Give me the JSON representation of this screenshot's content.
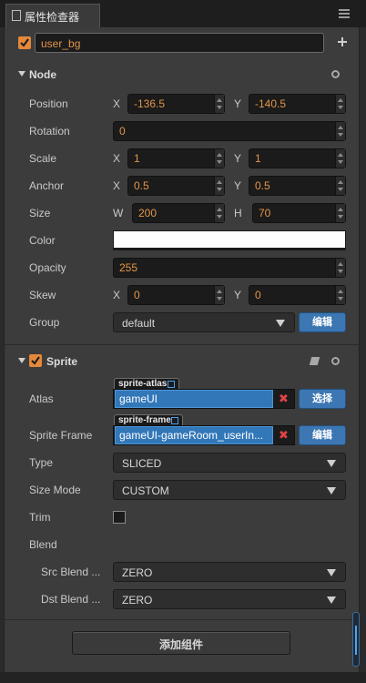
{
  "tab": {
    "title": "属性检查器"
  },
  "node_name": {
    "value": "user_bg"
  },
  "node_section": {
    "title": "Node"
  },
  "position": {
    "label": "Position",
    "x_axis": "X",
    "x": "-136.5",
    "y_axis": "Y",
    "y": "-140.5"
  },
  "rotation": {
    "label": "Rotation",
    "value": "0"
  },
  "scale": {
    "label": "Scale",
    "x_axis": "X",
    "x": "1",
    "y_axis": "Y",
    "y": "1"
  },
  "anchor": {
    "label": "Anchor",
    "x_axis": "X",
    "x": "0.5",
    "y_axis": "Y",
    "y": "0.5"
  },
  "size": {
    "label": "Size",
    "w_axis": "W",
    "w": "200",
    "h_axis": "H",
    "h": "70"
  },
  "color": {
    "label": "Color",
    "value": "#ffffff"
  },
  "opacity": {
    "label": "Opacity",
    "value": "255"
  },
  "skew": {
    "label": "Skew",
    "x_axis": "X",
    "x": "0",
    "y_axis": "Y",
    "y": "0"
  },
  "group": {
    "label": "Group",
    "value": "default",
    "edit_button": "编辑"
  },
  "sprite_section": {
    "title": "Sprite"
  },
  "atlas": {
    "label": "Atlas",
    "tag": "sprite-atlas",
    "value": "gameUI",
    "button": "选择"
  },
  "sprite_frame": {
    "label": "Sprite Frame",
    "tag": "sprite-frame",
    "value": "gameUI-gameRoom_userIn...",
    "button": "编辑"
  },
  "type": {
    "label": "Type",
    "value": "SLICED"
  },
  "size_mode": {
    "label": "Size Mode",
    "value": "CUSTOM"
  },
  "trim": {
    "label": "Trim"
  },
  "blend": {
    "label": "Blend"
  },
  "src_blend": {
    "label": "Src Blend ...",
    "value": "ZERO"
  },
  "dst_blend": {
    "label": "Dst Blend ...",
    "value": "ZERO"
  },
  "add_component": {
    "label": "添加组件"
  },
  "colors": {
    "accent": "#e4883a",
    "value_text": "#e39549",
    "button_blue": "#3c77b3"
  }
}
